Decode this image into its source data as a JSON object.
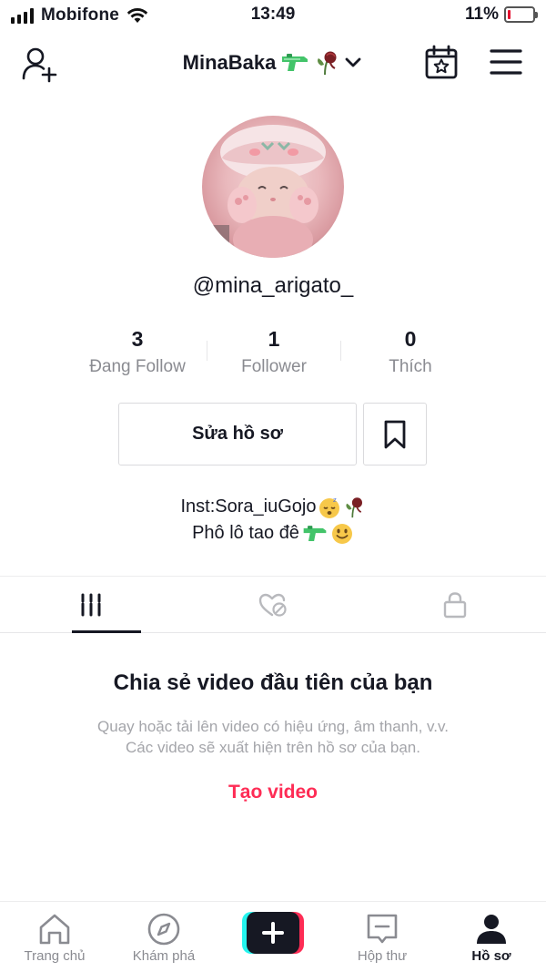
{
  "status_bar": {
    "carrier": "Mobifone",
    "time": "13:49",
    "battery_percent": "11%",
    "battery_level": 0.11,
    "battery_color": "#e3102e"
  },
  "header": {
    "username": "MinaBaka",
    "icons": [
      "add-user-icon",
      "chevron-down-icon",
      "calendar-star-icon",
      "menu-icon"
    ]
  },
  "profile": {
    "handle": "@mina_arigato_",
    "stats": [
      {
        "value": "3",
        "label": "Đang Follow"
      },
      {
        "value": "1",
        "label": "Follower"
      },
      {
        "value": "0",
        "label": "Thích"
      }
    ],
    "edit_button": "Sửa hồ sơ",
    "bio_line1": "Inst:Sora_iuGojo",
    "bio_line2": "Phô lô tao đê"
  },
  "tabs": [
    {
      "icon": "grid-icon",
      "active": true
    },
    {
      "icon": "liked-hidden-icon",
      "active": false
    },
    {
      "icon": "lock-icon",
      "active": false
    }
  ],
  "empty_state": {
    "title": "Chia sẻ video đầu tiên của bạn",
    "description_line1": "Quay hoặc tải lên video có hiệu ứng, âm thanh, v.v.",
    "description_line2": "Các video sẽ xuất hiện trên hồ sơ của bạn.",
    "cta": "Tạo video"
  },
  "bottom_nav": [
    {
      "label": "Trang chủ",
      "icon": "home-icon"
    },
    {
      "label": "Khám phá",
      "icon": "compass-icon"
    },
    {
      "label": "",
      "icon": "plus-icon"
    },
    {
      "label": "Hộp thư",
      "icon": "inbox-icon"
    },
    {
      "label": "Hồ sơ",
      "icon": "profile-icon",
      "active": true
    }
  ],
  "colors": {
    "accent": "#fe2c55",
    "text": "#161823",
    "muted": "#8a8b91"
  }
}
